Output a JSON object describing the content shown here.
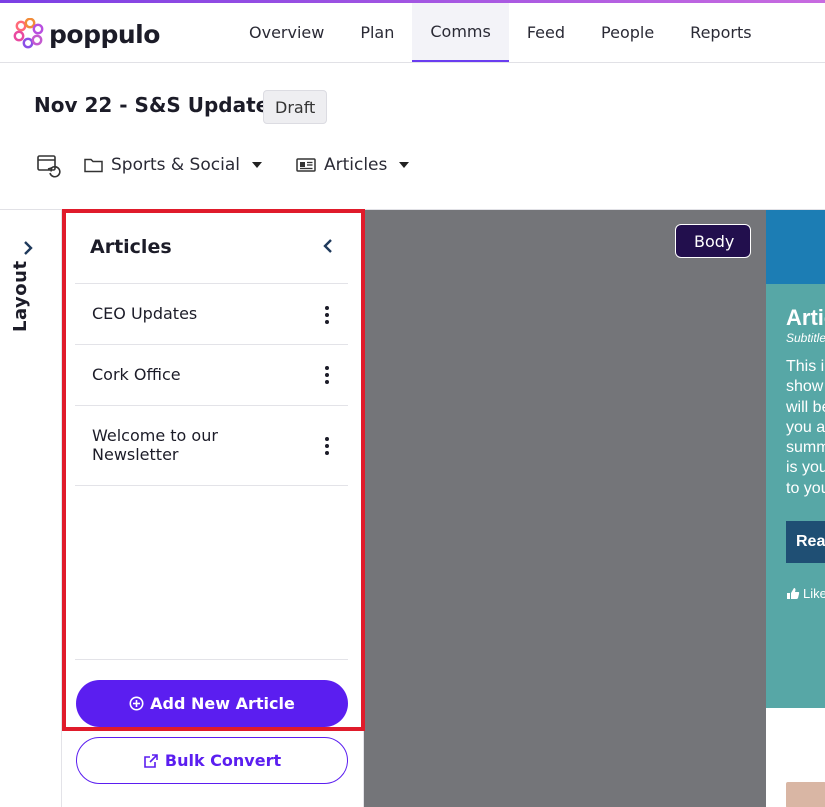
{
  "app": {
    "brand": "poppulo",
    "accent_color": "#5b1ef0",
    "highlight_color": "#e01b2b"
  },
  "nav": {
    "items": [
      {
        "label": "Overview",
        "active": false
      },
      {
        "label": "Plan",
        "active": false
      },
      {
        "label": "Comms",
        "active": true
      },
      {
        "label": "Feed",
        "active": false
      },
      {
        "label": "People",
        "active": false
      },
      {
        "label": "Reports",
        "active": false
      }
    ]
  },
  "page": {
    "title": "Nov 22 - S&S Update",
    "status_badge": "Draft"
  },
  "toolbar": {
    "history_icon": "restore-icon",
    "channel": {
      "label": "Sports & Social",
      "icon": "folder-icon"
    },
    "view": {
      "label": "Articles",
      "icon": "newspaper-icon"
    }
  },
  "layout_rail": {
    "label": "Layout"
  },
  "articles_panel": {
    "title": "Articles",
    "items": [
      {
        "label": "CEO Updates"
      },
      {
        "label": "Cork Office"
      },
      {
        "label": "Welcome to our Newsletter"
      }
    ],
    "add_button": "Add New Article",
    "bulk_button": "Bulk Convert"
  },
  "canvas": {
    "section_tag": "Body",
    "preview": {
      "title": "Artic",
      "subtitle": "Subtitle",
      "body_lines": [
        "This i",
        "show",
        "will be",
        "you a",
        "summ",
        "is you",
        "to you"
      ],
      "read_button": "Rea",
      "like_label": "Like"
    }
  }
}
